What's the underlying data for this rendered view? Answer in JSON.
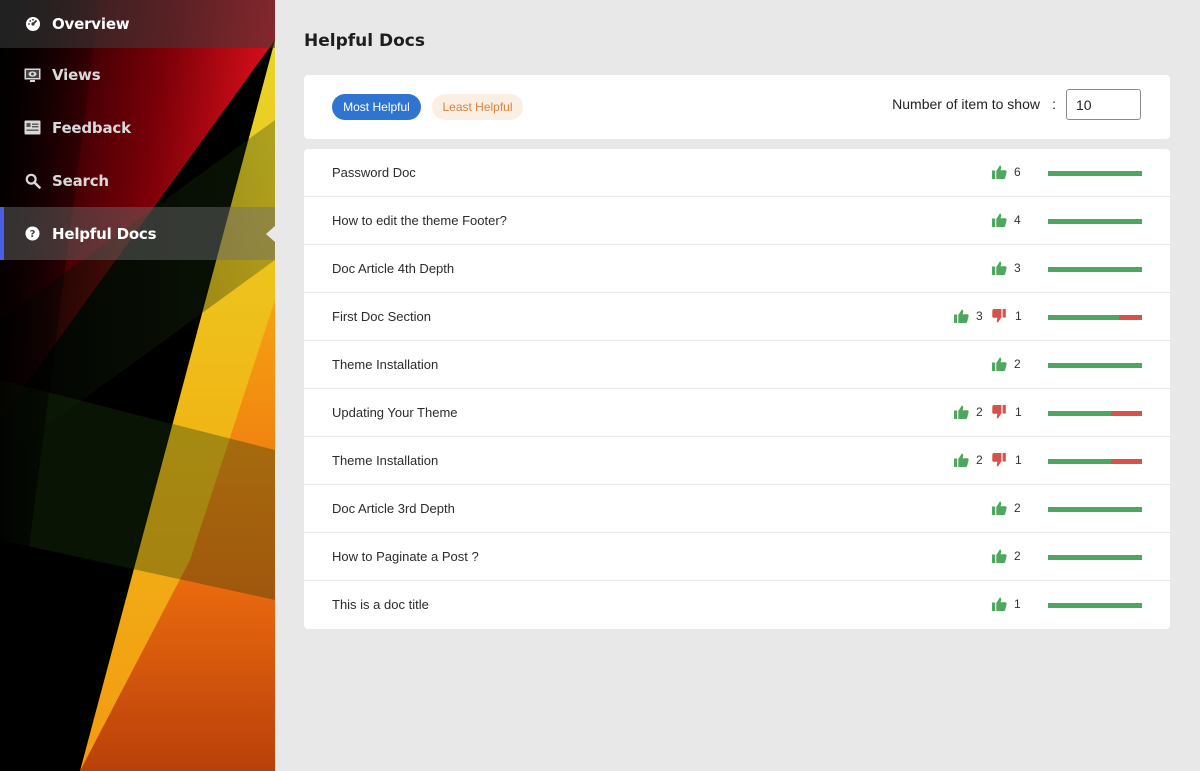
{
  "sidebar": {
    "items": [
      {
        "label": "Overview",
        "icon": "dashboard-icon"
      },
      {
        "label": "Views",
        "icon": "monitor-icon"
      },
      {
        "label": "Feedback",
        "icon": "feedback-icon"
      },
      {
        "label": "Search",
        "icon": "search-icon"
      },
      {
        "label": "Helpful Docs",
        "icon": "help-circle-icon",
        "active": true
      }
    ]
  },
  "main": {
    "title": "Helpful Docs",
    "toolbar": {
      "most_helpful_label": "Most Helpful",
      "least_helpful_label": "Least Helpful",
      "count_label": "Number of item to show",
      "count_separator": ":",
      "count_value": "10"
    },
    "docs": [
      {
        "title": "Password Doc",
        "up": 6,
        "down": 0
      },
      {
        "title": "How to edit the theme Footer?",
        "up": 4,
        "down": 0
      },
      {
        "title": "Doc Article 4th Depth",
        "up": 3,
        "down": 0
      },
      {
        "title": "First Doc Section",
        "up": 3,
        "down": 1
      },
      {
        "title": "Theme Installation",
        "up": 2,
        "down": 0
      },
      {
        "title": "Updating Your Theme",
        "up": 2,
        "down": 1
      },
      {
        "title": "Theme Installation",
        "up": 2,
        "down": 1
      },
      {
        "title": "Doc Article 3rd Depth",
        "up": 2,
        "down": 0
      },
      {
        "title": "How to Paginate a Post ?",
        "up": 2,
        "down": 0
      },
      {
        "title": "This is a doc title",
        "up": 1,
        "down": 0
      }
    ]
  },
  "colors": {
    "accent": "#2f74d0",
    "upvote": "#4ea75e",
    "downvote": "#d7514a",
    "active_indicator": "#4a5ee8"
  }
}
